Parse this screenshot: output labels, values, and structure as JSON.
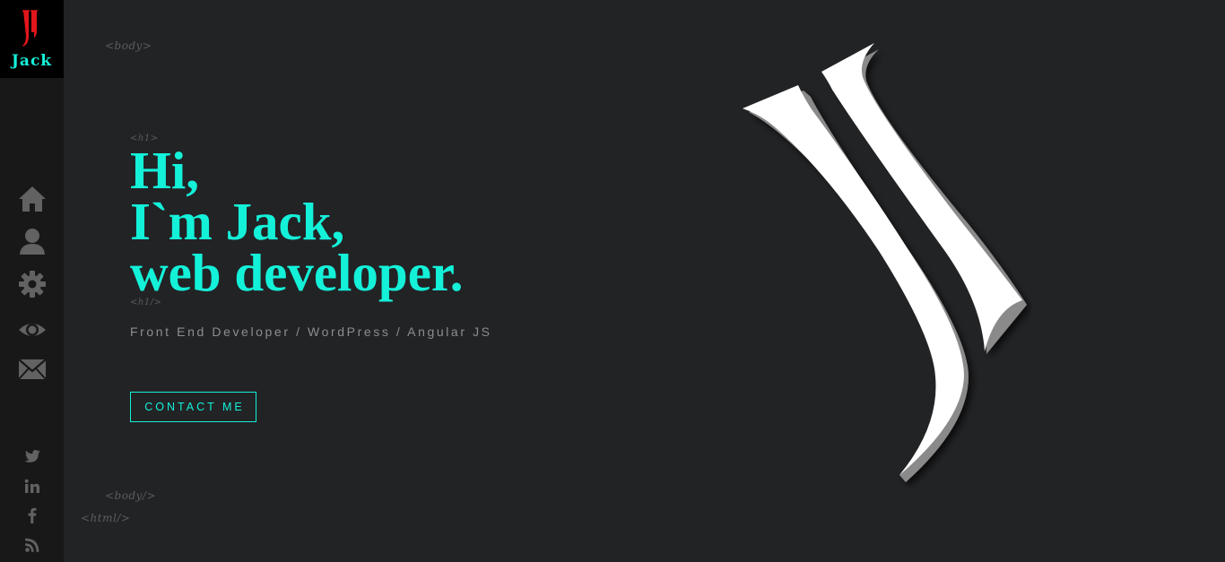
{
  "brand": {
    "name": "Jack",
    "accent": "#14f1d9",
    "logo_color": "#e0161c"
  },
  "nav": [
    {
      "icon": "home-icon"
    },
    {
      "icon": "user-icon"
    },
    {
      "icon": "gear-icon"
    },
    {
      "icon": "eye-icon"
    },
    {
      "icon": "envelope-icon"
    }
  ],
  "social": [
    {
      "icon": "twitter-icon"
    },
    {
      "icon": "linkedin-icon"
    },
    {
      "icon": "facebook-icon"
    },
    {
      "icon": "rss-icon"
    }
  ],
  "tags": {
    "body_open": "<body>",
    "h1_open": "<h1>",
    "h1_close": "<h1/>",
    "body_close": "<body/>",
    "html_close": "<html/>"
  },
  "hero": {
    "line1": "Hi,",
    "line2": "I`m Jack,",
    "line3": "web developer.",
    "subtitle": "Front End Developer / WordPress / Angular JS",
    "button_label": "CONTACT ME"
  },
  "colors": {
    "background": "#222325",
    "sidebar": "#181818",
    "tag_text": "#5b5d60",
    "subtitle_text": "#8d8d8d",
    "icon": "#626262"
  }
}
